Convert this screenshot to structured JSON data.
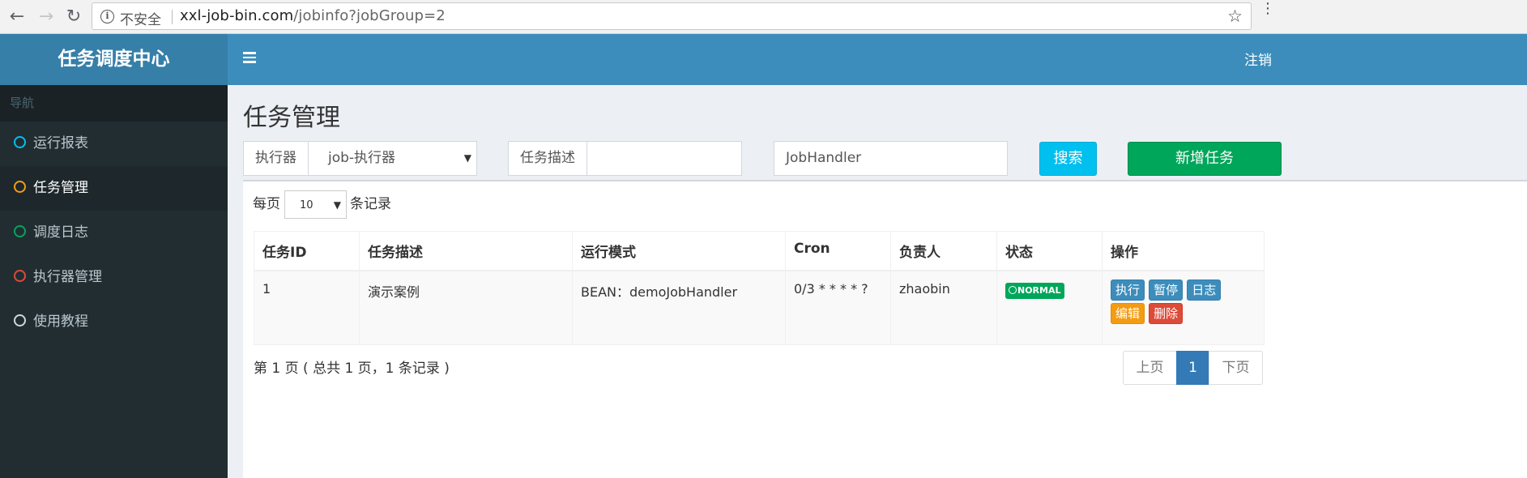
{
  "browser": {
    "insecure_label": "不安全",
    "url_host": "xxl-job-bin.com",
    "url_path": "/jobinfo?jobGroup=2"
  },
  "header": {
    "logo": "任务调度中心",
    "logout": "注销"
  },
  "sidebar": {
    "header": "导航",
    "items": [
      {
        "label": "运行报表",
        "color": "#00c0ef"
      },
      {
        "label": "任务管理",
        "color": "#f39c12"
      },
      {
        "label": "调度日志",
        "color": "#00a65a"
      },
      {
        "label": "执行器管理",
        "color": "#dd4b39"
      },
      {
        "label": "使用教程",
        "color": "#d2d6de"
      }
    ]
  },
  "main": {
    "title": "任务管理",
    "filters": {
      "executor_label": "执行器",
      "executor_value": "job-执行器",
      "desc_label": "任务描述",
      "desc_value": "",
      "handler_label": "JobHandler",
      "handler_value": "",
      "search_button": "搜索",
      "add_button": "新增任务"
    },
    "page_size": {
      "prefix": "每页",
      "value": "10",
      "suffix": "条记录"
    },
    "table": {
      "columns": [
        "任务ID",
        "任务描述",
        "运行模式",
        "Cron",
        "负责人",
        "状态",
        "操作"
      ],
      "rows": [
        {
          "id": "1",
          "desc": "演示案例",
          "mode": "BEAN：demoJobHandler",
          "cron": "0/3 * * * * ?",
          "owner": "zhaobin",
          "status": "NORMAL",
          "actions": {
            "trigger": "执行",
            "pause": "暂停",
            "log": "日志",
            "edit": "编辑",
            "delete": "删除"
          }
        }
      ]
    },
    "pagination": {
      "info": "第 1 页 ( 总共 1 页，1 条记录 )",
      "prev": "上页",
      "current": "1",
      "next": "下页"
    }
  }
}
